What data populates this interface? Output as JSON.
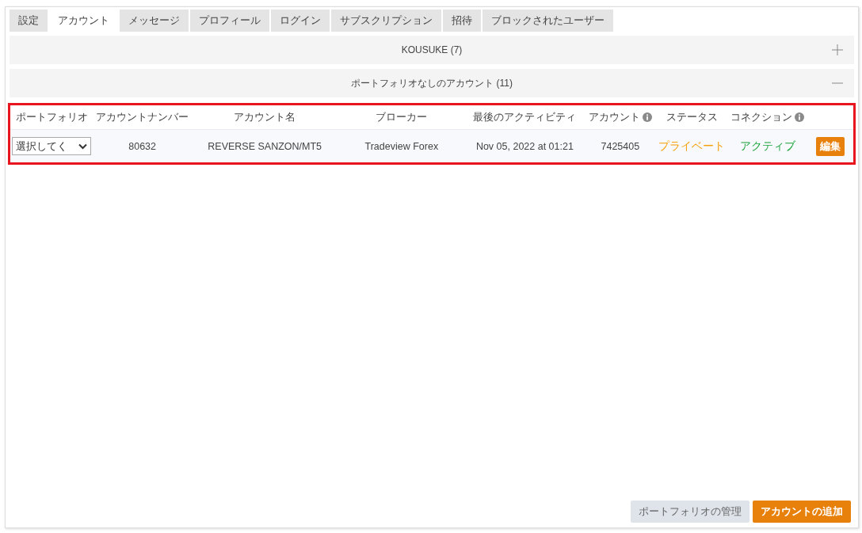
{
  "tabs": [
    {
      "label": "設定",
      "selected": false
    },
    {
      "label": "アカウント",
      "selected": true
    },
    {
      "label": "メッセージ",
      "selected": false
    },
    {
      "label": "プロフィール",
      "selected": false
    },
    {
      "label": "ログイン",
      "selected": false
    },
    {
      "label": "サブスクリプション",
      "selected": false
    },
    {
      "label": "招待",
      "selected": false
    },
    {
      "label": "ブロックされたユーザー",
      "selected": false
    }
  ],
  "sections": [
    {
      "title": "KOUSUKE (7)",
      "expanded": false
    },
    {
      "title": "ポートフォリオなしのアカウント (11)",
      "expanded": true
    }
  ],
  "table": {
    "highlighted": true,
    "columns": [
      {
        "label": "ポートフォリオ",
        "info": false
      },
      {
        "label": "アカウントナンバー",
        "info": false
      },
      {
        "label": "アカウント名",
        "info": false
      },
      {
        "label": "ブローカー",
        "info": false
      },
      {
        "label": "最後のアクティビティ",
        "info": false
      },
      {
        "label": "アカウント",
        "info": true
      },
      {
        "label": "ステータス",
        "info": false
      },
      {
        "label": "コネクション",
        "info": true
      },
      {}
    ],
    "rows": [
      {
        "cells": [
          {
            "kind": "select",
            "text": "選択してく"
          },
          {
            "kind": "text",
            "text": "80632"
          },
          {
            "kind": "text",
            "text": "REVERSE SANZON/MT5"
          },
          {
            "kind": "text",
            "text": "Tradeview Forex"
          },
          {
            "kind": "text",
            "text": "Nov 05, 2022 at 01:21"
          },
          {
            "kind": "text",
            "text": "7425405"
          },
          {
            "kind": "status",
            "text": "プライベート",
            "color": "#f5a00a"
          },
          {
            "kind": "status",
            "text": "アクティブ",
            "color": "#1aa33a"
          },
          {
            "kind": "button",
            "text": "編集"
          }
        ]
      }
    ]
  },
  "buttons": [
    {
      "label": "ポートフォリオの管理",
      "kind": "secondary"
    },
    {
      "label": "アカウントの追加",
      "kind": "primary"
    }
  ]
}
